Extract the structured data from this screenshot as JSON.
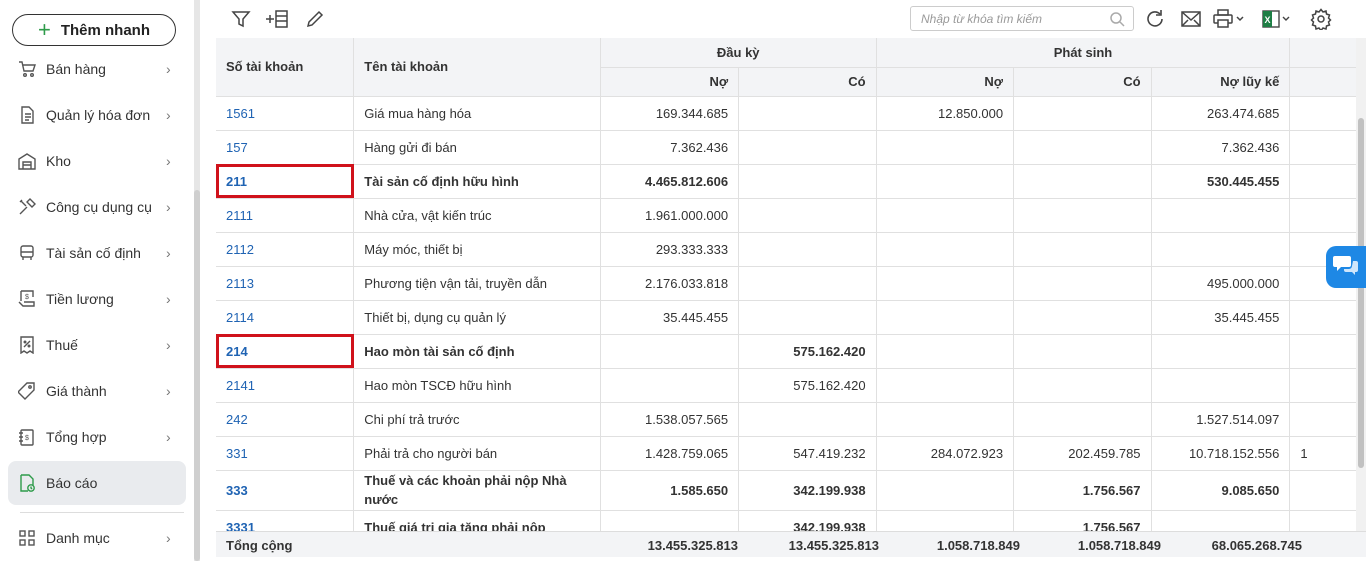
{
  "sidebar": {
    "quick_add": "Thêm nhanh",
    "items": [
      {
        "label": "Bán hàng",
        "icon": "cart-icon"
      },
      {
        "label": "Quản lý hóa đơn",
        "icon": "invoice-icon"
      },
      {
        "label": "Kho",
        "icon": "warehouse-icon"
      },
      {
        "label": "Công cụ dụng cụ",
        "icon": "tools-icon"
      },
      {
        "label": "Tài sản cố định",
        "icon": "car-icon"
      },
      {
        "label": "Tiền lương",
        "icon": "salary-icon"
      },
      {
        "label": "Thuế",
        "icon": "tax-icon"
      },
      {
        "label": "Giá thành",
        "icon": "price-tag-icon"
      },
      {
        "label": "Tổng hợp",
        "icon": "summary-icon"
      },
      {
        "label": "Báo cáo",
        "icon": "report-icon"
      },
      {
        "label": "Danh mục",
        "icon": "grid-icon"
      }
    ]
  },
  "toolbar": {
    "search_placeholder": "Nhập từ khóa tìm kiếm",
    "icons": [
      "filter-icon",
      "add-column-icon",
      "edit-icon",
      "search-icon",
      "refresh-icon",
      "email-icon",
      "print-icon",
      "excel-icon",
      "settings-icon"
    ]
  },
  "table": {
    "headers": {
      "account_no": "Số tài khoản",
      "account_name": "Tên tài khoản",
      "opening": "Đầu kỳ",
      "movement": "Phát sinh",
      "debit": "Nợ",
      "credit": "Có",
      "cumulative_debit": "Nợ lũy kế"
    },
    "rows": [
      {
        "acct": "1561",
        "name": "Giá mua hàng hóa",
        "od": "169.344.685",
        "oc": "",
        "pd": "12.850.000",
        "pc": "",
        "cd": "263.474.685",
        "bold": false
      },
      {
        "acct": "157",
        "name": "Hàng gửi đi bán",
        "od": "7.362.436",
        "oc": "",
        "pd": "",
        "pc": "",
        "cd": "7.362.436",
        "bold": false
      },
      {
        "acct": "211",
        "name": "Tài sản cố định hữu hình",
        "od": "4.465.812.606",
        "oc": "",
        "pd": "",
        "pc": "",
        "cd": "530.445.455",
        "bold": true,
        "highlight": true
      },
      {
        "acct": "2111",
        "name": "Nhà cửa, vật kiến trúc",
        "od": "1.961.000.000",
        "oc": "",
        "pd": "",
        "pc": "",
        "cd": "",
        "bold": false
      },
      {
        "acct": "2112",
        "name": "Máy móc, thiết bị",
        "od": "293.333.333",
        "oc": "",
        "pd": "",
        "pc": "",
        "cd": "",
        "bold": false
      },
      {
        "acct": "2113",
        "name": "Phương tiện vận tải, truyền dẫn",
        "od": "2.176.033.818",
        "oc": "",
        "pd": "",
        "pc": "",
        "cd": "495.000.000",
        "bold": false
      },
      {
        "acct": "2114",
        "name": "Thiết bị, dụng cụ quản lý",
        "od": "35.445.455",
        "oc": "",
        "pd": "",
        "pc": "",
        "cd": "35.445.455",
        "bold": false
      },
      {
        "acct": "214",
        "name": "Hao mòn tài sản cố định",
        "od": "",
        "oc": "575.162.420",
        "pd": "",
        "pc": "",
        "cd": "",
        "bold": true,
        "highlight": true
      },
      {
        "acct": "2141",
        "name": "Hao mòn TSCĐ hữu hình",
        "od": "",
        "oc": "575.162.420",
        "pd": "",
        "pc": "",
        "cd": "",
        "bold": false
      },
      {
        "acct": "242",
        "name": "Chi phí trả trước",
        "od": "1.538.057.565",
        "oc": "",
        "pd": "",
        "pc": "",
        "cd": "1.527.514.097",
        "bold": false
      },
      {
        "acct": "331",
        "name": "Phải trả cho người bán",
        "od": "1.428.759.065",
        "oc": "547.419.232",
        "pd": "284.072.923",
        "pc": "202.459.785",
        "cd": "10.718.152.556",
        "extra": "1",
        "bold": false
      },
      {
        "acct": "333",
        "name": "Thuế và các khoản phải nộp Nhà nước",
        "od": "1.585.650",
        "oc": "342.199.938",
        "pd": "",
        "pc": "1.756.567",
        "cd": "9.085.650",
        "bold": true,
        "tall": true
      },
      {
        "acct": "3331",
        "name": "Thuế giá trị gia tăng phải nộp",
        "od": "",
        "oc": "342.199.938",
        "pd": "",
        "pc": "1.756.567",
        "cd": "",
        "bold": true
      }
    ],
    "totals": {
      "label": "Tổng cộng",
      "od": "13.455.325.813",
      "oc": "13.455.325.813",
      "pd": "1.058.718.849",
      "pc": "1.058.718.849",
      "cd": "68.065.268.745"
    }
  },
  "colors": {
    "accent": "#1f63b3",
    "highlight": "#d0121b",
    "chat": "#1e88e5"
  }
}
